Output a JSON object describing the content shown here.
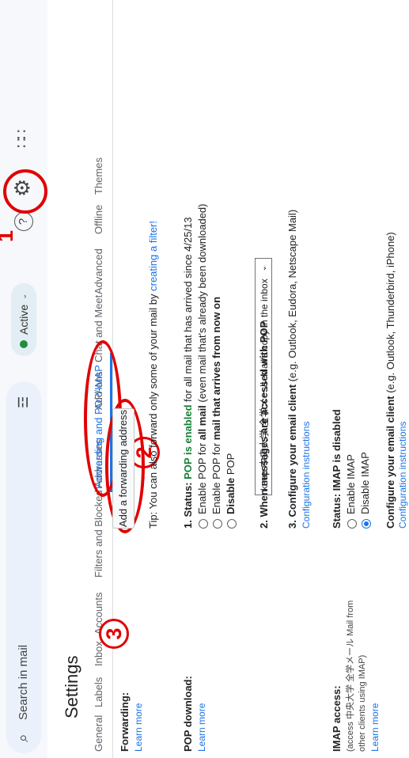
{
  "search": {
    "placeholder": "Search in mail"
  },
  "header": {
    "status": "Active",
    "help": "?"
  },
  "settings_title": "Settings",
  "tabs": [
    "General",
    "Labels",
    "Inbox",
    "Accounts",
    "Filters and Blocked Addresses",
    "Forwarding and POP/IMAP",
    "Add-ons",
    "Chat and Meet",
    "Advanced",
    "Offline",
    "Themes"
  ],
  "annotations": [
    "1",
    "2",
    "3"
  ],
  "forwarding": {
    "label": "Forwarding:",
    "learn_more": "Learn more",
    "button": "Add a forwarding address",
    "tip_prefix": "Tip: You can also forward only some of your mail by ",
    "tip_link": "creating a filter!"
  },
  "pop": {
    "label": "POP download:",
    "learn_more": "Learn more",
    "status_prefix": "1. Status: ",
    "status_value": "POP is enabled",
    "status_suffix": " for all mail that has arrived since 4/25/13",
    "option1_prefix": "Enable POP for ",
    "option1_bold": "all mail",
    "option1_suffix": " (even mail that's already been downloaded)",
    "option2_prefix": "Enable POP for ",
    "option2_bold": "mail that arrives from now on",
    "option3": "Disable",
    "option3_suffix": " POP",
    "when_label": "2. When messages are accessed with POP",
    "when_value": "keep 中央大学 全学メール Mail's copy in the inbox",
    "configure_label": "3. Configure your email client",
    "configure_suffix": " (e.g. Outlook, Eudora, Netscape Mail)",
    "config_link": "Configuration instructions"
  },
  "imap": {
    "label": "IMAP access:",
    "note_line1": "(access 中央大学 全学メール Mail from",
    "note_line2": "other clients using IMAP)",
    "learn_more": "Learn more",
    "status": "Status: IMAP is disabled",
    "enable": "Enable IMAP",
    "disable": "Disable IMAP",
    "configure_label": "Configure your email client",
    "configure_suffix": " (e.g. Outlook, Thunderbird, iPhone)",
    "config_link": "Configuration instructions"
  }
}
